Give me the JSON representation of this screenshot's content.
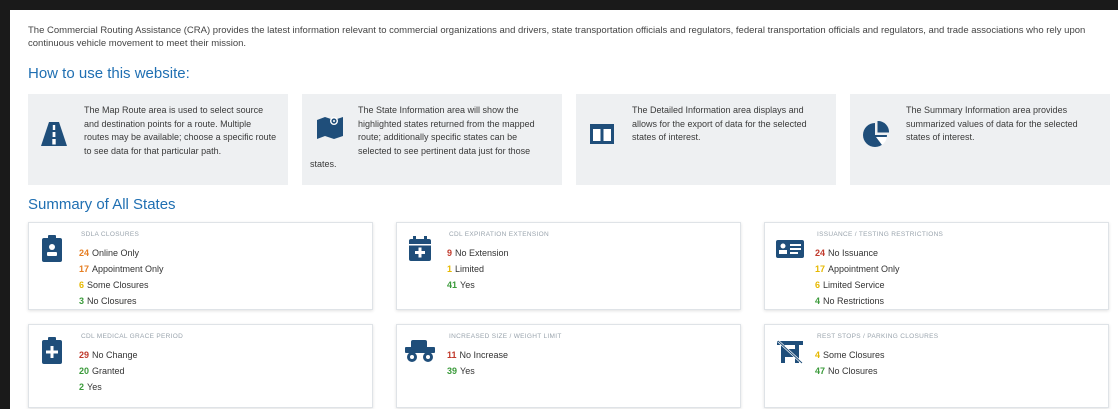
{
  "intro": "The Commercial Routing Assistance (CRA) provides the latest information relevant to commercial organizations and drivers, state transportation officials and regulators, federal transportation officials and regulators, and trade associations who rely upon continuous vehicle movement to meet their mission.",
  "how_heading": "How to use this website:",
  "how_cards": [
    {
      "icon": "road-icon",
      "text": "The Map Route area is used to select source and destination points for a route. Multiple routes may be available; choose a specific route to see data for that particular path."
    },
    {
      "icon": "map-icon",
      "text": "The State Information area will show the highlighted states returned from the mapped route; additionally specific states can be selected to see pertinent data just for those",
      "text_tail": "states."
    },
    {
      "icon": "table-columns-icon",
      "text": "The Detailed Information area displays and allows for the export of data for the selected states of interest."
    },
    {
      "icon": "pie-chart-icon",
      "text": "The Summary Information area provides summarized values of data for the selected states of interest."
    }
  ],
  "summary_heading": "Summary of All States",
  "stat_cards": [
    {
      "icon": "clipboard-id-icon",
      "title": "SDLA CLOSURES",
      "rows": [
        {
          "num": "24",
          "label": "Online Only",
          "color": "#e67e22"
        },
        {
          "num": "17",
          "label": "Appointment Only",
          "color": "#e67e22"
        },
        {
          "num": "6",
          "label": "Some Closures",
          "color": "#e6b800"
        },
        {
          "num": "3",
          "label": "No Closures",
          "color": "#3a9a3a"
        }
      ]
    },
    {
      "icon": "calendar-plus-icon",
      "title": "CDL EXPIRATION EXTENSION",
      "rows": [
        {
          "num": "9",
          "label": "No Extension",
          "color": "#c0392b"
        },
        {
          "num": "1",
          "label": "Limited",
          "color": "#e6b800"
        },
        {
          "num": "41",
          "label": "Yes",
          "color": "#3a9a3a"
        }
      ]
    },
    {
      "icon": "id-card-icon",
      "title": "ISSUANCE / TESTING RESTRICTIONS",
      "rows": [
        {
          "num": "24",
          "label": "No Issuance",
          "color": "#c0392b"
        },
        {
          "num": "17",
          "label": "Appointment Only",
          "color": "#e6b800"
        },
        {
          "num": "6",
          "label": "Limited Service",
          "color": "#e6b800"
        },
        {
          "num": "4",
          "label": "No Restrictions",
          "color": "#3a9a3a"
        }
      ]
    },
    {
      "icon": "medical-clipboard-icon",
      "title": "CDL MEDICAL GRACE PERIOD",
      "rows": [
        {
          "num": "29",
          "label": "No Change",
          "color": "#c0392b"
        },
        {
          "num": "20",
          "label": "Granted",
          "color": "#3a9a3a"
        },
        {
          "num": "2",
          "label": "Yes",
          "color": "#3a9a3a"
        }
      ]
    },
    {
      "icon": "truck-icon",
      "title": "INCREASED SIZE / WEIGHT LIMIT",
      "rows": [
        {
          "num": "11",
          "label": "No Increase",
          "color": "#c0392b"
        },
        {
          "num": "39",
          "label": "Yes",
          "color": "#3a9a3a"
        }
      ]
    },
    {
      "icon": "rest-stop-closed-icon",
      "title": "REST STOPS / PARKING CLOSURES",
      "rows": [
        {
          "num": "4",
          "label": "Some Closures",
          "color": "#e6b800"
        },
        {
          "num": "47",
          "label": "No Closures",
          "color": "#3a9a3a"
        }
      ]
    }
  ]
}
